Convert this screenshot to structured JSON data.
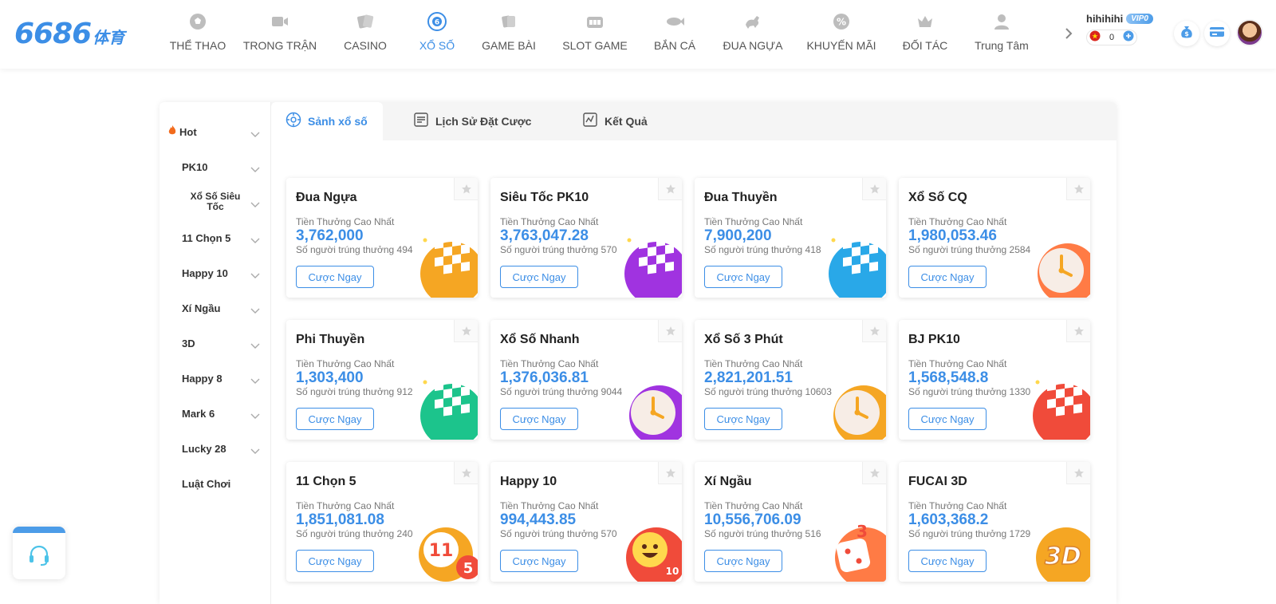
{
  "brand": {
    "logo_number": "6686",
    "logo_cn": "体育"
  },
  "nav": [
    {
      "label": "THỂ THAO",
      "icon": "soccer-ball-icon"
    },
    {
      "label": "TRONG TRẬN",
      "icon": "video-camera-icon"
    },
    {
      "label": "CASINO",
      "icon": "cards-icon"
    },
    {
      "label": "XỔ SỐ",
      "icon": "lottery-ball-icon",
      "active": true
    },
    {
      "label": "GAME BÀI",
      "icon": "card-game-icon"
    },
    {
      "label": "SLOT GAME",
      "icon": "slot-machine-icon"
    },
    {
      "label": "BẮN CÁ",
      "icon": "fish-icon"
    },
    {
      "label": "ĐUA NGỰA",
      "icon": "horse-icon"
    },
    {
      "label": "KHUYẾN MÃI",
      "icon": "promo-percent-icon"
    },
    {
      "label": "ĐỐI TÁC",
      "icon": "crown-icon"
    },
    {
      "label": "Trung Tâm",
      "icon": "user-center-icon"
    }
  ],
  "user": {
    "name": "hihihihi",
    "vip": "VIP0",
    "balance": "0"
  },
  "sidebar": [
    {
      "label": "Hot",
      "icon": "fire-icon",
      "chevron": true
    },
    {
      "label": "PK10",
      "chevron": true
    },
    {
      "label": "Xổ Số Siêu Tốc",
      "chevron": true
    },
    {
      "label": "11 Chọn 5",
      "chevron": true
    },
    {
      "label": "Happy 10",
      "chevron": true
    },
    {
      "label": "Xí Ngầu",
      "chevron": true
    },
    {
      "label": "3D",
      "chevron": true
    },
    {
      "label": "Happy 8",
      "chevron": true
    },
    {
      "label": "Mark 6",
      "chevron": true
    },
    {
      "label": "Lucky 28",
      "chevron": true
    },
    {
      "label": "Luật Chơi",
      "chevron": false
    }
  ],
  "tabs": [
    {
      "label": "Sảnh xổ số",
      "icon": "lobby-icon",
      "active": true
    },
    {
      "label": "Lịch Sử Đặt Cược",
      "icon": "history-icon"
    },
    {
      "label": "Kết Quả",
      "icon": "results-chart-icon"
    }
  ],
  "card_labels": {
    "prize_label": "Tiền Thưởng Cao Nhất",
    "winners_prefix": "Số người trúng thưởng",
    "bet_button": "Cược Ngay"
  },
  "games": [
    {
      "title": "Đua Ngựa",
      "amount": "3,762,000",
      "winners": "Số người trúng thưởng 494",
      "art": "checkered-flag-icon",
      "color": "#f5a623"
    },
    {
      "title": "Siêu Tốc PK10",
      "amount": "3,763,047.28",
      "winners": "Số người trúng thưởng 570",
      "art": "checkered-flag-icon",
      "color": "#a033e0"
    },
    {
      "title": "Đua Thuyền",
      "amount": "7,900,200",
      "winners": "Số người trúng thưởng 418",
      "art": "checkered-flag-icon",
      "color": "#29a8e8"
    },
    {
      "title": "Xổ Số CQ",
      "amount": "1,980,053.46",
      "winners": "Số người trúng thưởng 2584",
      "art": "clock-icon",
      "color": "#ff7b45"
    },
    {
      "title": "Phi Thuyền",
      "amount": "1,303,400",
      "winners": "Số người trúng thưởng 912",
      "art": "checkered-flag-icon",
      "color": "#1cc48c"
    },
    {
      "title": "Xổ Số Nhanh",
      "amount": "1,376,036.81",
      "winners": "Số người trúng thưởng 9044",
      "art": "clock-icon",
      "color": "#a033e0"
    },
    {
      "title": "Xổ Số 3 Phút",
      "amount": "2,821,201.51",
      "winners": "Số người trúng thưởng 10603",
      "art": "clock-icon",
      "color": "#f5a623"
    },
    {
      "title": "BJ PK10",
      "amount": "1,568,548.8",
      "winners": "Số người trúng thưởng 1330",
      "art": "checkered-flag-icon",
      "color": "#f04b3a"
    },
    {
      "title": "11 Chọn 5",
      "amount": "1,851,081.08",
      "winners": "Số người trúng thưởng 240",
      "art": "lottery-balls-icon",
      "color": "#f5a623"
    },
    {
      "title": "Happy 10",
      "amount": "994,443.85",
      "winners": "Số người trúng thưởng 570",
      "art": "smiley-ball-icon",
      "color": "#f04b3a"
    },
    {
      "title": "Xí Ngầu",
      "amount": "10,556,706.09",
      "winners": "Số người trúng thưởng 516",
      "art": "dice-icon",
      "color": "#ff7b45"
    },
    {
      "title": "FUCAI 3D",
      "amount": "1,603,368.2",
      "winners": "Số người trúng thưởng 1729",
      "art": "3d-text-icon",
      "color": "#f5a623"
    }
  ],
  "colors": {
    "accent": "#3c8ee6",
    "text": "#333333",
    "muted": "#777777"
  }
}
